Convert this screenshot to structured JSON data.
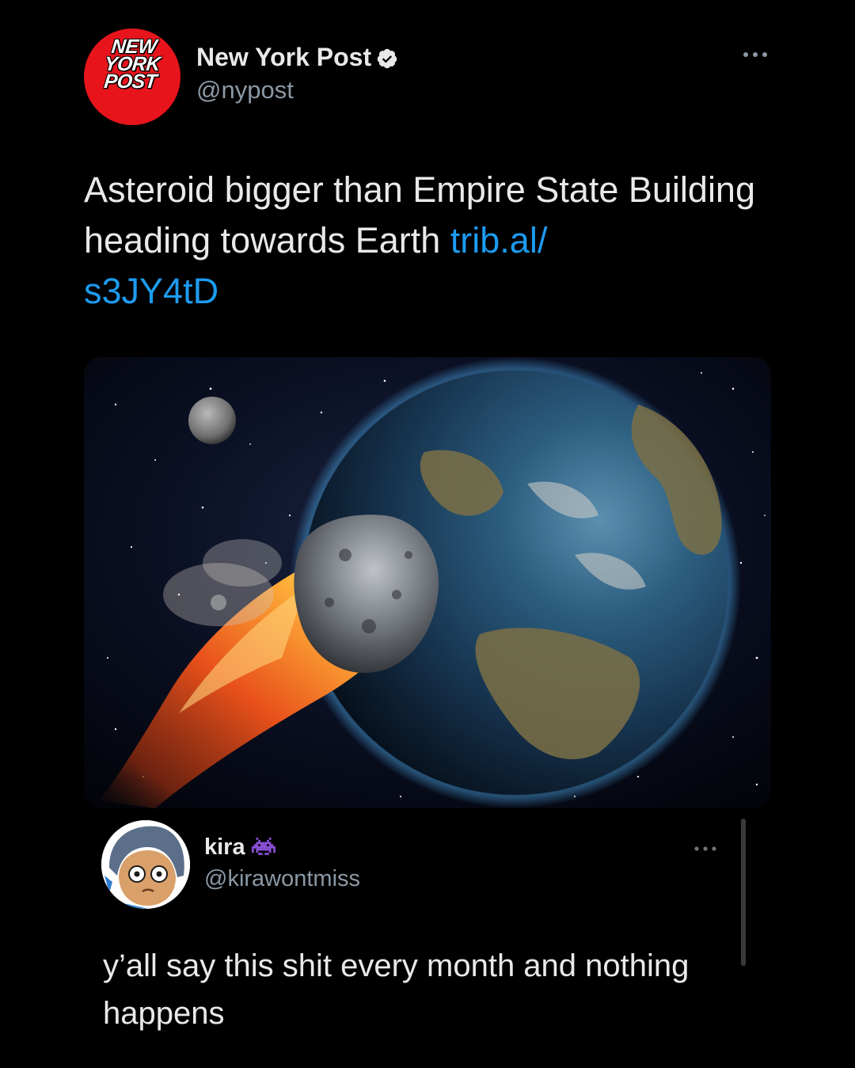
{
  "tweet": {
    "author": {
      "name": "New York Post",
      "handle": "@nypost",
      "verified": true,
      "avatar_logo_lines": [
        "NEW",
        "YORK",
        "POST"
      ]
    },
    "more_icon": "more-horizontal-icon",
    "text": "Asteroid bigger than Empire State Building heading towards Earth ",
    "link": "trib.al/\ns3JY4tD",
    "media_icon": "asteroid-earth-image"
  },
  "reply": {
    "author": {
      "name": "kira",
      "handle": "@kirawontmiss",
      "name_emoji": "alien-monster-icon"
    },
    "more_icon": "more-horizontal-icon",
    "text": "y’all say this shit every month and nothing happens"
  },
  "colors": {
    "background": "#000000",
    "text": "#e7e9ea",
    "secondary_text": "#8b98a5",
    "link": "#1d9bf0",
    "nyp_red": "#e8141c"
  }
}
